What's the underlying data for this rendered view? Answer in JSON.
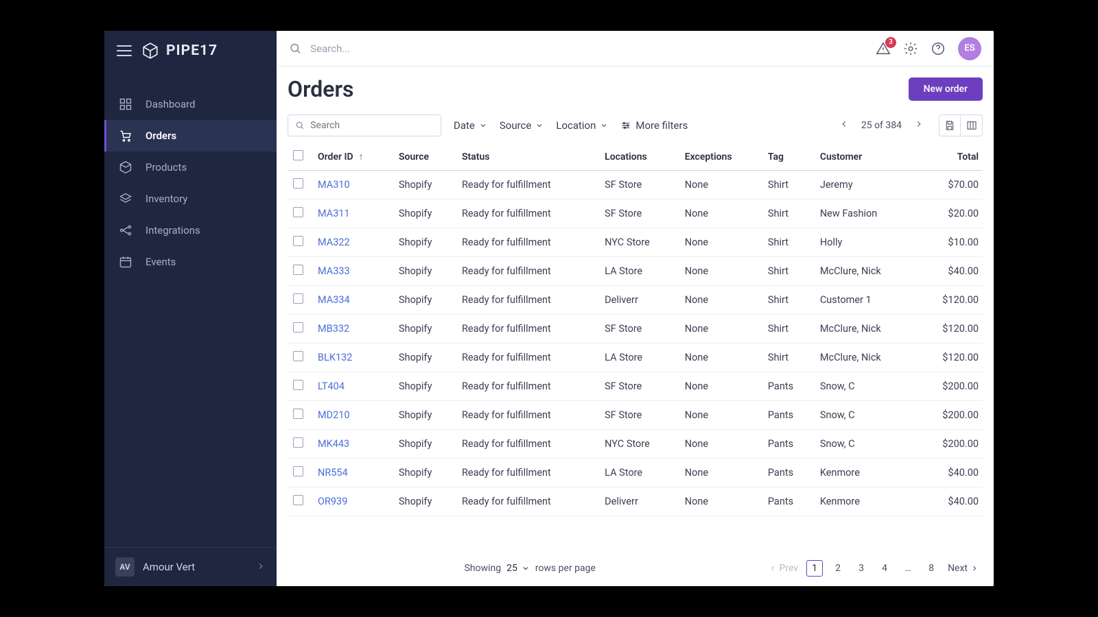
{
  "brand": {
    "name": "PIPE17"
  },
  "sidebar": {
    "items": [
      {
        "label": "Dashboard"
      },
      {
        "label": "Orders"
      },
      {
        "label": "Products"
      },
      {
        "label": "Inventory"
      },
      {
        "label": "Integrations"
      },
      {
        "label": "Events"
      }
    ],
    "footer": {
      "initials": "AV",
      "name": "Amour Vert"
    }
  },
  "header": {
    "search_placeholder": "Search...",
    "notifications_count": "3",
    "user_initials": "ES"
  },
  "page": {
    "title": "Orders",
    "new_button": "New order"
  },
  "toolbar": {
    "search_placeholder": "Search",
    "filters": {
      "date": "Date",
      "source": "Source",
      "location": "Location",
      "more": "More filters"
    },
    "counter": "25 of 384"
  },
  "table": {
    "columns": [
      "Order ID",
      "Source",
      "Status",
      "Locations",
      "Exceptions",
      "Tag",
      "Customer",
      "Total"
    ],
    "rows": [
      {
        "id": "MA310",
        "source": "Shopify",
        "status": "Ready for fulfillment",
        "location": "SF Store",
        "exceptions": "None",
        "tag": "Shirt",
        "customer": "Jeremy",
        "total": "$70.00"
      },
      {
        "id": "MA311",
        "source": "Shopify",
        "status": "Ready for fulfillment",
        "location": "SF Store",
        "exceptions": "None",
        "tag": "Shirt",
        "customer": "New Fashion",
        "total": "$20.00"
      },
      {
        "id": "MA322",
        "source": "Shopify",
        "status": "Ready for fulfillment",
        "location": "NYC Store",
        "exceptions": "None",
        "tag": "Shirt",
        "customer": "Holly",
        "total": "$10.00"
      },
      {
        "id": "MA333",
        "source": "Shopify",
        "status": "Ready for fulfillment",
        "location": "LA Store",
        "exceptions": "None",
        "tag": "Shirt",
        "customer": "McClure, Nick",
        "total": "$40.00"
      },
      {
        "id": "MA334",
        "source": "Shopify",
        "status": "Ready for fulfillment",
        "location": "Deliverr",
        "exceptions": "None",
        "tag": "Shirt",
        "customer": "Customer 1",
        "total": "$120.00"
      },
      {
        "id": "MB332",
        "source": "Shopify",
        "status": "Ready for fulfillment",
        "location": "SF Store",
        "exceptions": "None",
        "tag": "Shirt",
        "customer": "McClure, Nick",
        "total": "$120.00"
      },
      {
        "id": "BLK132",
        "source": "Shopify",
        "status": "Ready for fulfillment",
        "location": "LA Store",
        "exceptions": "None",
        "tag": "Shirt",
        "customer": "McClure, Nick",
        "total": "$120.00"
      },
      {
        "id": "LT404",
        "source": "Shopify",
        "status": "Ready for fulfillment",
        "location": "SF Store",
        "exceptions": "None",
        "tag": "Pants",
        "customer": "Snow, C",
        "total": "$200.00"
      },
      {
        "id": "MD210",
        "source": "Shopify",
        "status": "Ready for fulfillment",
        "location": "SF Store",
        "exceptions": "None",
        "tag": "Pants",
        "customer": "Snow, C",
        "total": "$200.00"
      },
      {
        "id": "MK443",
        "source": "Shopify",
        "status": "Ready for fulfillment",
        "location": "NYC Store",
        "exceptions": "None",
        "tag": "Pants",
        "customer": "Snow, C",
        "total": "$200.00"
      },
      {
        "id": "NR554",
        "source": "Shopify",
        "status": "Ready for fulfillment",
        "location": "LA Store",
        "exceptions": "None",
        "tag": "Pants",
        "customer": "Kenmore",
        "total": "$40.00"
      },
      {
        "id": "OR939",
        "source": "Shopify",
        "status": "Ready for fulfillment",
        "location": "Deliverr",
        "exceptions": "None",
        "tag": "Pants",
        "customer": "Kenmore",
        "total": "$40.00"
      }
    ]
  },
  "pagination": {
    "showing_label": "Showing",
    "rows_per_page": "25",
    "rows_suffix": "rows per page",
    "prev": "Prev",
    "next": "Next",
    "pages": [
      "1",
      "2",
      "3",
      "4",
      "…",
      "8"
    ],
    "active": "1"
  }
}
